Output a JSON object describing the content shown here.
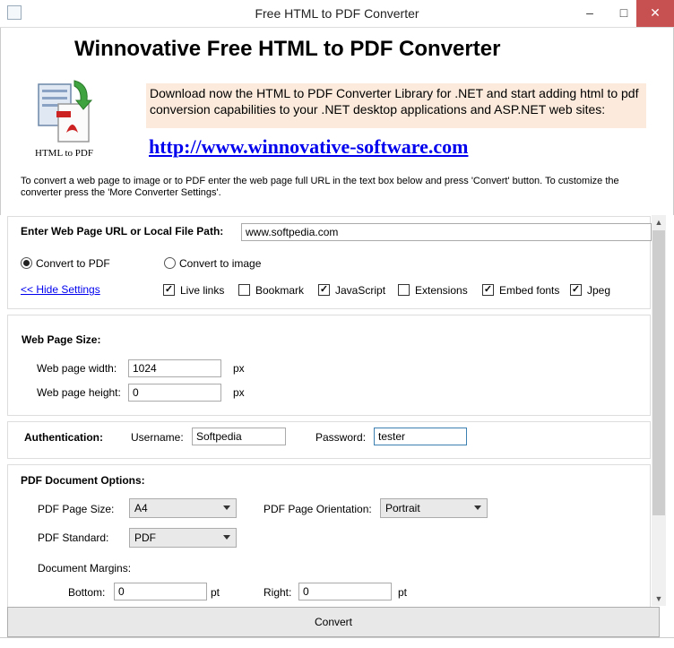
{
  "window": {
    "title": "Free HTML to PDF Converter",
    "min_icon": "–",
    "max_icon": "□",
    "close_icon": "✕"
  },
  "header": {
    "main_title": "Winnovative Free HTML to PDF Converter",
    "logo_caption": "HTML to PDF",
    "promo_text": "Download now the HTML to PDF Converter  Library for .NET and start adding html to pdf conversion capabilities to your .NET desktop applications and ASP.NET web sites:",
    "site_link": "http://www.winnovative-software.com",
    "instructions": "To convert a web page to image or to PDF enter the web page full URL in the text box below and press 'Convert' button. To customize the converter press the 'More Converter Settings'."
  },
  "url_panel": {
    "url_label": "Enter Web Page URL or Local File Path:",
    "url_value": "www.softpedia.com",
    "radio_pdf_label": "Convert to PDF",
    "radio_image_label": "Convert to image",
    "hide_settings_link": "<< Hide Settings",
    "checkboxes": [
      {
        "label": "Live links",
        "checked": true
      },
      {
        "label": "Bookmark",
        "checked": false
      },
      {
        "label": "JavaScript",
        "checked": true
      },
      {
        "label": "Extensions",
        "checked": false
      },
      {
        "label": "Embed fonts",
        "checked": true
      },
      {
        "label": "Jpeg",
        "checked": true
      }
    ],
    "check_mark": "✓"
  },
  "size_panel": {
    "heading": "Web Page Size:",
    "width_label": "Web page width:",
    "width_value": "1024",
    "height_label": "Web page height:",
    "height_value": "0",
    "unit": "px"
  },
  "auth_panel": {
    "heading": "Authentication:",
    "username_label": "Username:",
    "username_value": "Softpedia",
    "password_label": "Password:",
    "password_value": "tester"
  },
  "pdf_panel": {
    "heading": "PDF Document Options:",
    "page_size_label": "PDF Page Size:",
    "page_size_value": "A4",
    "orientation_label": "PDF Page Orientation:",
    "orientation_value": "Portrait",
    "standard_label": "PDF Standard:",
    "standard_value": "PDF",
    "margins_label": "Document Margins:",
    "bottom_label": "Bottom:",
    "bottom_value": "0",
    "right_label": "Right:",
    "right_value": "0",
    "unit": "pt"
  },
  "footer": {
    "convert_label": "Convert"
  },
  "colors": {
    "promo_bg": "#fcebdc",
    "link": "#0000ee",
    "close_btn": "#c75050"
  }
}
